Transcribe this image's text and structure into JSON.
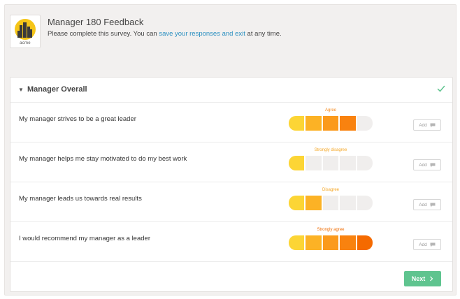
{
  "header": {
    "logo_text": "acme",
    "title": "Manager 180 Feedback",
    "subtitle_before": "Please complete this survey. You can ",
    "subtitle_link": "save your responses and exit",
    "subtitle_after": " at any time."
  },
  "section": {
    "title": "Manager Overall",
    "complete_icon": "check-icon"
  },
  "scale_colors": [
    "#fcd535",
    "#fcb225",
    "#fb9a1c",
    "#f9820f",
    "#f56a00"
  ],
  "empty_color": "#f0eeed",
  "questions": [
    {
      "text": "My manager strives to be a great leader",
      "rating_label": "Agree",
      "rating_color": "#f58a1f",
      "rating": 4,
      "add_label": "Add"
    },
    {
      "text": "My manager helps me stay motivated to do my best work",
      "rating_label": "Strongly disagree",
      "rating_color": "#f5a623",
      "rating": 1,
      "add_label": "Add"
    },
    {
      "text": "My manager leads us towards real results",
      "rating_label": "Disagree",
      "rating_color": "#f5a623",
      "rating": 2,
      "add_label": "Add"
    },
    {
      "text": "I would recommend my manager as a leader",
      "rating_label": "Strongly agree",
      "rating_color": "#f06b00",
      "rating": 5,
      "add_label": "Add"
    }
  ],
  "footer": {
    "next_label": "Next",
    "next_icon": "chevron-right-icon"
  }
}
